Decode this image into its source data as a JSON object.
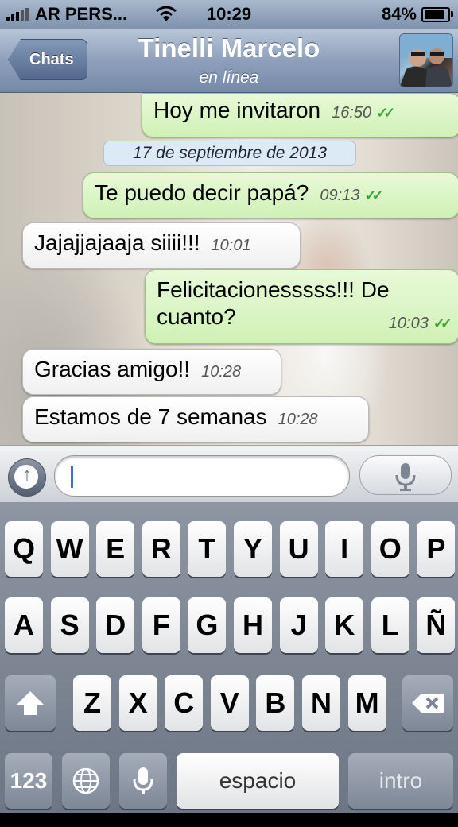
{
  "status_bar": {
    "carrier": "AR PERS...",
    "time": "10:29",
    "battery": "84%",
    "battery_level": 0.84
  },
  "nav": {
    "back_label": "Chats",
    "title": "Tinelli Marcelo",
    "subtitle": "en línea"
  },
  "messages": [
    {
      "dir": "out",
      "text": "Hoy me invitaron",
      "time": "16:50",
      "read": true
    },
    {
      "dir": "out",
      "text": "Te puedo decir papá?",
      "time": "09:13",
      "read": true
    },
    {
      "dir": "in",
      "text": "Jajajjajaaja siiii!!!",
      "time": "10:01"
    },
    {
      "dir": "out",
      "text_line1": "Felicitacionesssss!!! De",
      "text_line2": "cuanto?",
      "time": "10:03",
      "read": true
    },
    {
      "dir": "in",
      "text": "Gracias amigo!!",
      "time": "10:28"
    },
    {
      "dir": "in",
      "text": "Estamos de 7 semanas",
      "time": "10:28"
    }
  ],
  "date_separator": "17 de septiembre de 2013",
  "input": {
    "value": ""
  },
  "keyboard": {
    "row1": [
      "Q",
      "W",
      "E",
      "R",
      "T",
      "Y",
      "U",
      "I",
      "O",
      "P"
    ],
    "row2": [
      "A",
      "S",
      "D",
      "F",
      "G",
      "H",
      "J",
      "K",
      "L",
      "Ñ"
    ],
    "row3": [
      "Z",
      "X",
      "C",
      "V",
      "B",
      "N",
      "M"
    ],
    "numbers": "123",
    "space": "espacio",
    "return": "intro"
  },
  "icons": [
    "signal-icon",
    "wifi-icon",
    "battery-icon",
    "back-chevron-icon",
    "avatar",
    "attach-arrow-icon",
    "microphone-icon",
    "shift-icon",
    "backspace-icon",
    "globe-icon",
    "read-check-icon"
  ],
  "colors": {
    "outgoing_bubble": "#d0f1b6",
    "incoming_bubble": "#ffffff",
    "read_ticks": "#3fa43a",
    "nav_bar": "#8ea0bb"
  }
}
